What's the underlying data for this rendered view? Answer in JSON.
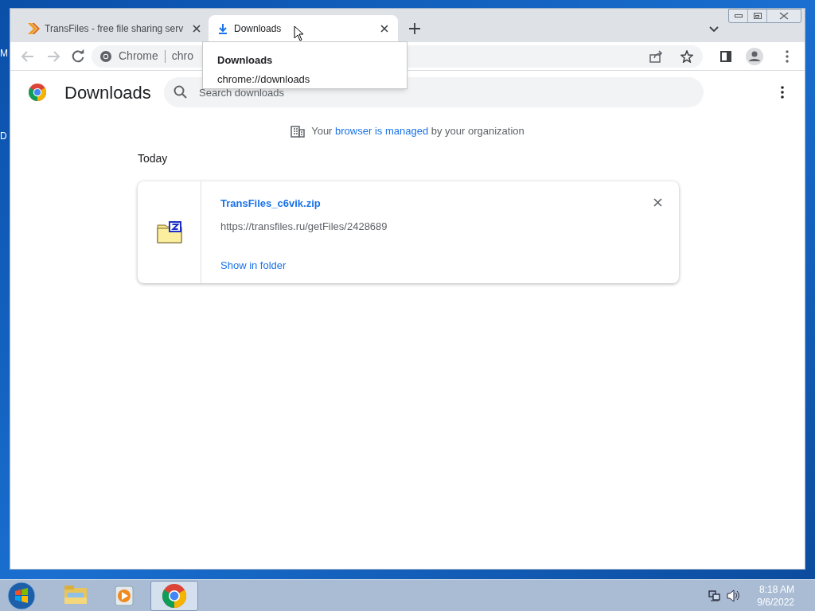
{
  "desktop_labels": [
    "M",
    "D"
  ],
  "tabs": [
    {
      "title": "TransFiles - free file sharing serv",
      "selected": false,
      "kind": "site"
    },
    {
      "title": "Downloads",
      "selected": true,
      "kind": "downloads"
    }
  ],
  "tooltip": {
    "title": "Downloads",
    "url": "chrome://downloads"
  },
  "omnibox": {
    "label": "Chrome",
    "text": "chro"
  },
  "page": {
    "title": "Downloads",
    "search": {
      "placeholder": "Search downloads"
    },
    "managed_notice": {
      "before": "Your",
      "link": "browser is managed",
      "after": "by your organization"
    },
    "groups": [
      {
        "date": "Today",
        "items": [
          {
            "name": "TransFiles_c6vik.zip",
            "url": "https://transfiles.ru/getFiles/2428689",
            "action": "Show in folder"
          }
        ]
      }
    ]
  },
  "taskbar": {
    "apps": [
      {
        "kind": "explorer",
        "selected": false
      },
      {
        "kind": "media",
        "selected": false
      },
      {
        "kind": "chrome",
        "selected": true
      }
    ],
    "time": "8:18 AM",
    "date": "9/6/2022"
  }
}
